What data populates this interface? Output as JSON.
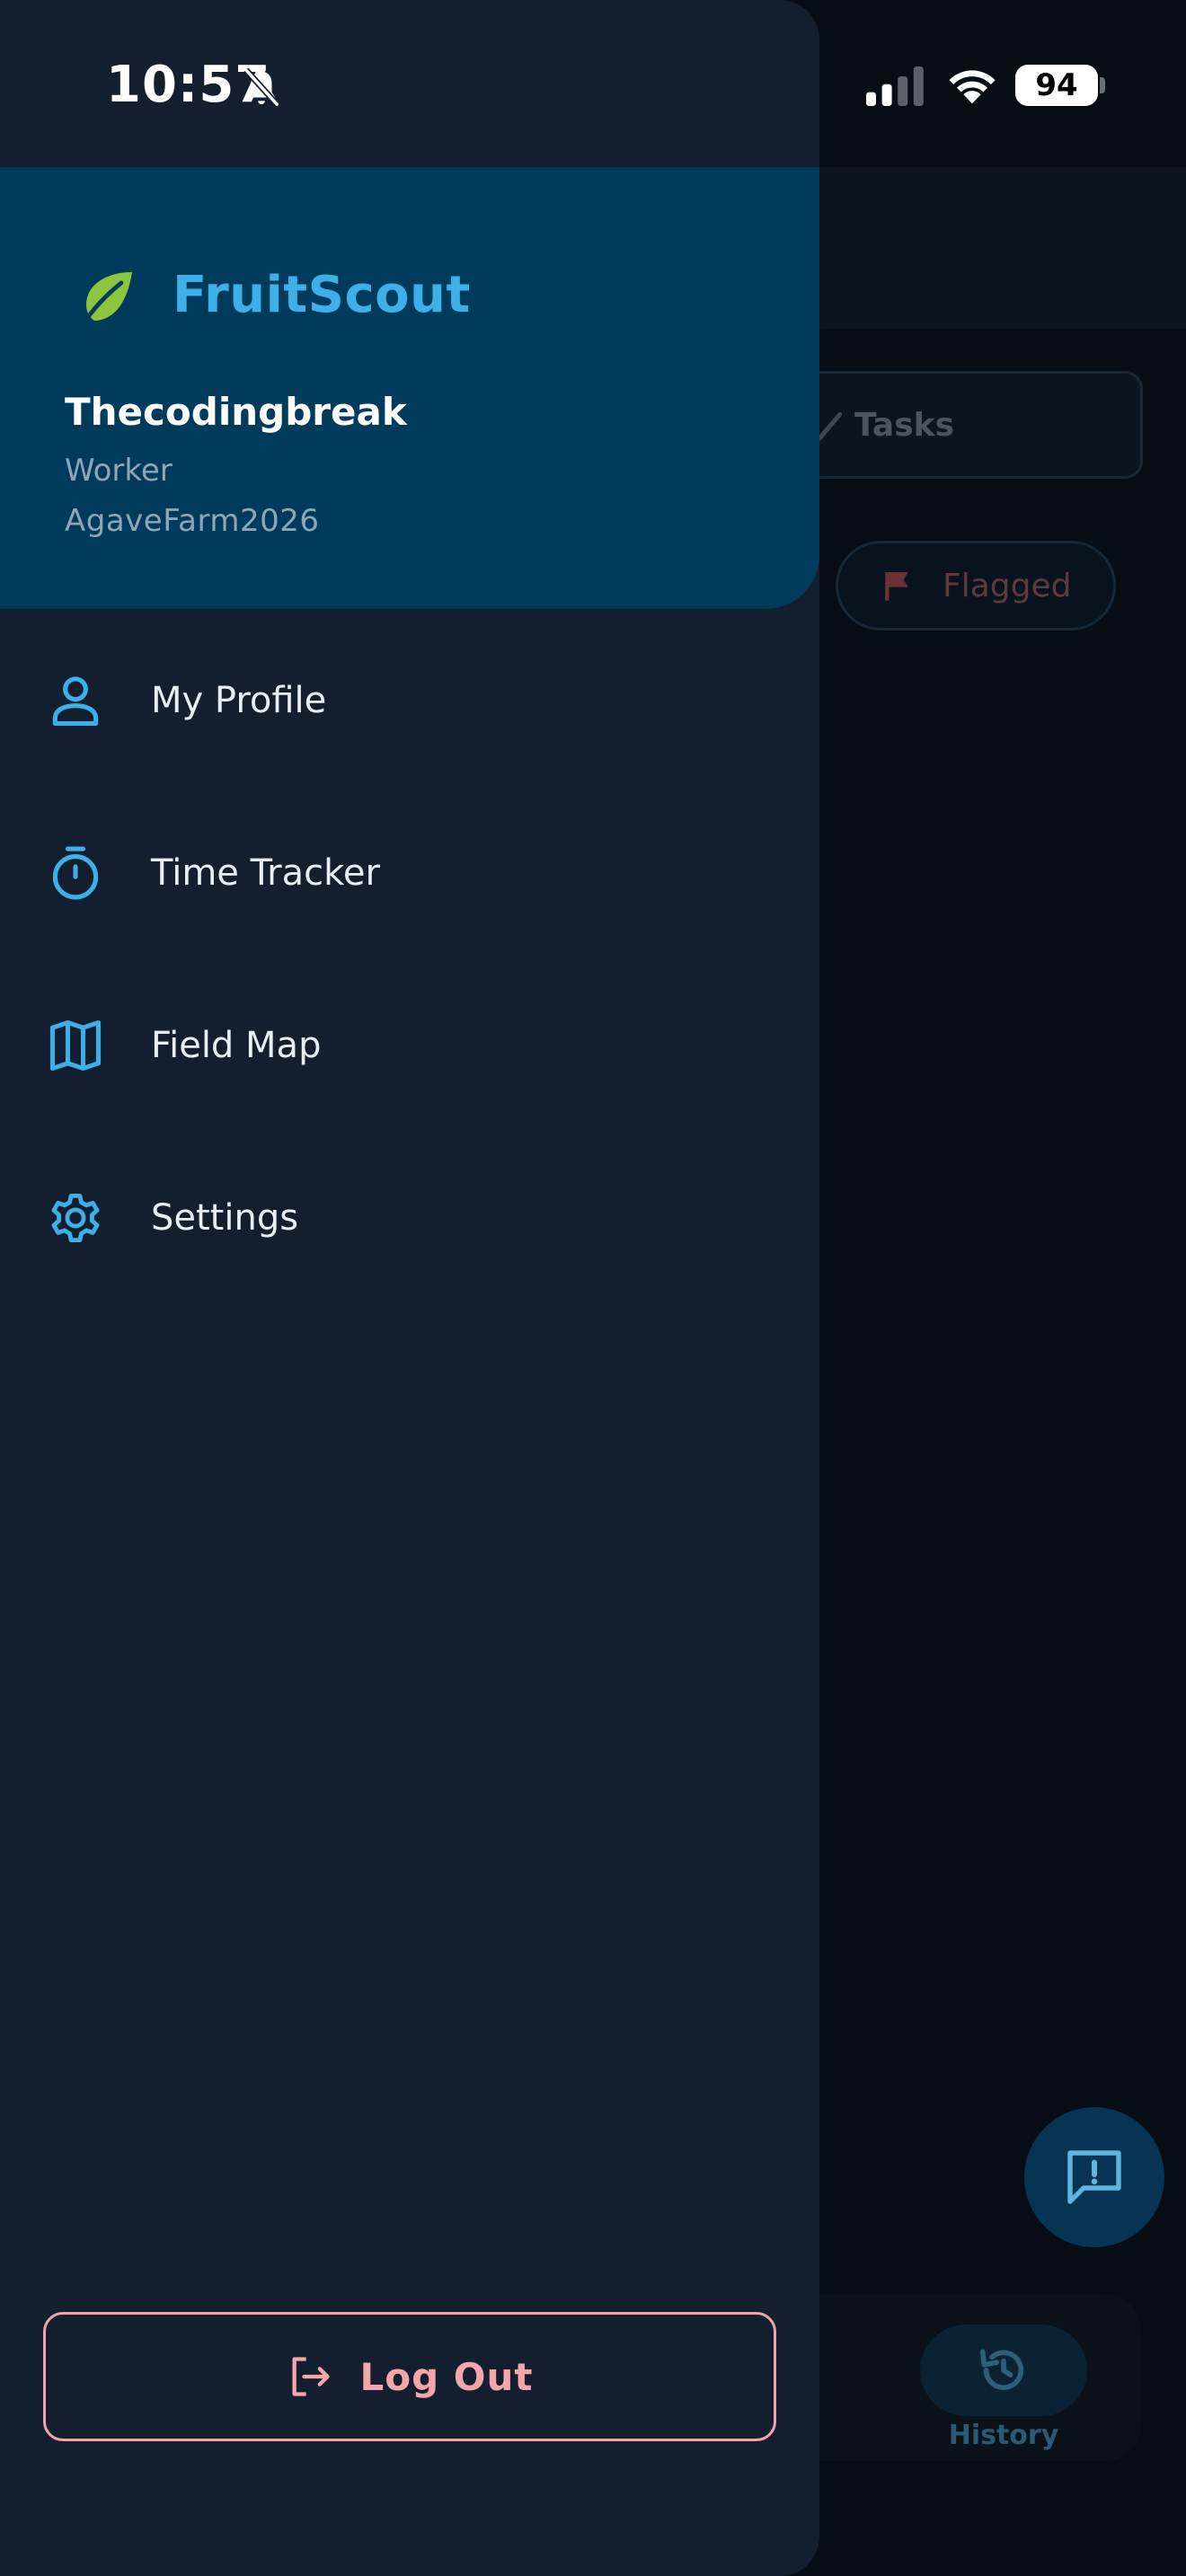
{
  "status_bar": {
    "time": "10:57",
    "battery": "94",
    "icons": [
      "bell-slash-icon",
      "signal-icon",
      "wifi-icon",
      "battery-icon"
    ]
  },
  "drawer": {
    "app_name": "FruitScout",
    "user": {
      "name": "Thecodingbreak",
      "role": "Worker",
      "farm": "AgaveFarm2026"
    },
    "menu": [
      {
        "label": "My Profile",
        "icon": "person-icon"
      },
      {
        "label": "Time Tracker",
        "icon": "stopwatch-icon"
      },
      {
        "label": "Field Map",
        "icon": "map-icon"
      },
      {
        "label": "Settings",
        "icon": "gear-icon"
      }
    ],
    "logout_label": "Log Out"
  },
  "background": {
    "tab_label": "Tasks",
    "chip_label": "Flagged",
    "nav_history_label": "History"
  },
  "colors": {
    "drawer_bg": "#131f2e",
    "header_bg": "#003b5c",
    "accent": "#3db0ea",
    "leaf": "#8cc63f",
    "logout": "#f4a6ab"
  }
}
